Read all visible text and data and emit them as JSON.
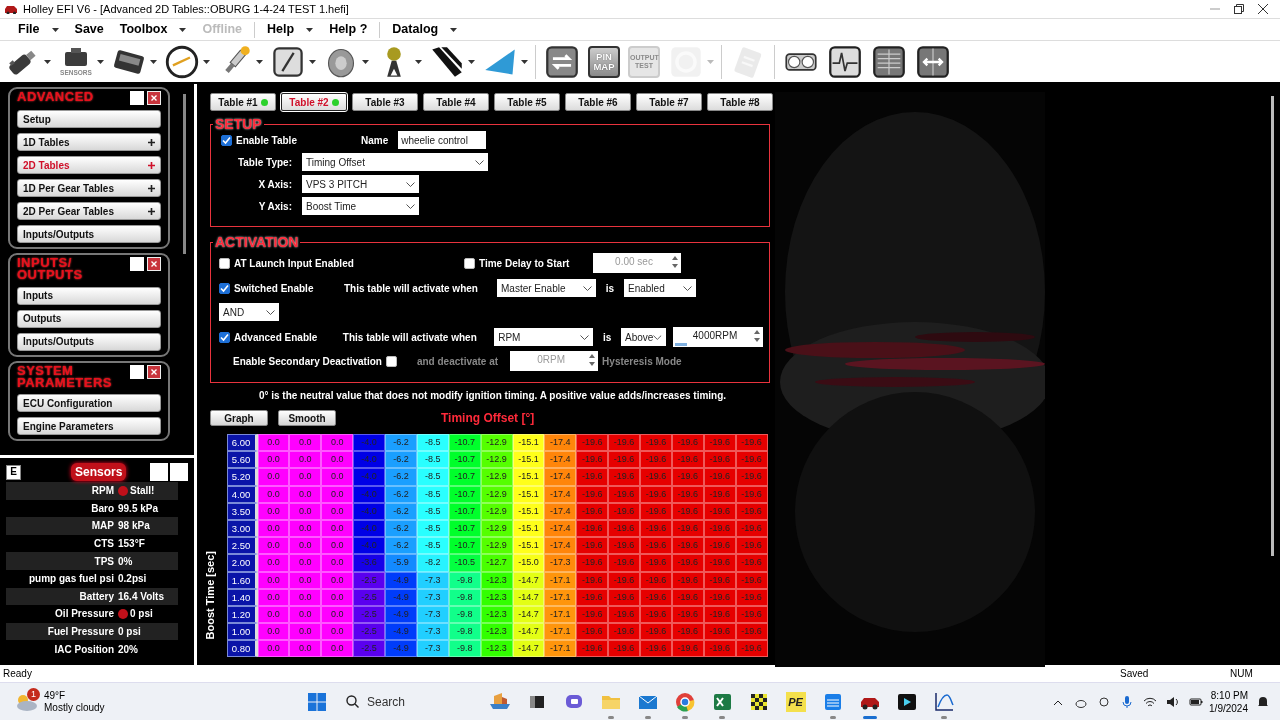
{
  "window": {
    "title": "Holley EFI V6 - [Advanced 2D Tables::OBURG 1-4-24 TEST 1.hefi]"
  },
  "menu_groups": [
    [
      {
        "label": "File",
        "dropdown": true,
        "disabled": false
      },
      {
        "label": "Save",
        "dropdown": false,
        "disabled": false
      },
      {
        "label": "Toolbox",
        "dropdown": true,
        "disabled": false
      },
      {
        "label": "Offline",
        "dropdown": false,
        "disabled": true
      }
    ],
    [
      {
        "label": "Help",
        "dropdown": true,
        "disabled": false
      },
      {
        "label": "Help ?",
        "dropdown": false,
        "disabled": false
      }
    ],
    [
      {
        "label": "Datalog",
        "dropdown": true,
        "disabled": false
      }
    ]
  ],
  "toolbar_groups": [
    [
      {
        "dropdown": true,
        "disabled": false
      },
      {
        "label": "SENSORS",
        "dropdown": true,
        "disabled": false
      },
      {
        "dropdown": true,
        "disabled": false
      },
      {
        "dropdown": true,
        "disabled": false
      },
      {
        "dropdown": true,
        "disabled": false
      },
      {
        "dropdown": true,
        "disabled": false
      },
      {
        "dropdown": true,
        "disabled": false
      },
      {
        "dropdown": true,
        "disabled": false
      },
      {
        "dropdown": true,
        "disabled": false
      },
      {
        "dropdown": true,
        "disabled": false
      }
    ],
    [
      {
        "dropdown": false,
        "disabled": false
      },
      {
        "label": "PIN MAP",
        "dropdown": false,
        "disabled": false
      },
      {
        "label": "OUTPUT TEST",
        "dropdown": false,
        "disabled": true
      },
      {
        "dropdown": true,
        "disabled": true
      }
    ],
    [
      {
        "dropdown": false,
        "disabled": true
      }
    ],
    [
      {
        "dropdown": false,
        "disabled": false
      },
      {
        "dropdown": false,
        "disabled": false
      },
      {
        "dropdown": false,
        "disabled": false
      },
      {
        "dropdown": false,
        "disabled": false
      }
    ]
  ],
  "side_panels": [
    {
      "title": "ADVANCED",
      "items": [
        {
          "label": "Setup",
          "expandable": false,
          "selected": false
        },
        {
          "label": "1D Tables",
          "expandable": true,
          "selected": false
        },
        {
          "label": "2D Tables",
          "expandable": true,
          "selected": true
        },
        {
          "label": "1D Per Gear Tables",
          "expandable": true,
          "selected": false
        },
        {
          "label": "2D Per Gear Tables",
          "expandable": true,
          "selected": false
        },
        {
          "label": "Inputs/Outputs",
          "expandable": false,
          "selected": false
        }
      ]
    },
    {
      "title": "INPUTS/ OUTPUTS",
      "items": [
        {
          "label": "Inputs",
          "expandable": false,
          "selected": false
        },
        {
          "label": "Outputs",
          "expandable": false,
          "selected": false
        },
        {
          "label": "Inputs/Outputs",
          "expandable": false,
          "selected": false
        }
      ]
    },
    {
      "title": "SYSTEM PARAMETERS",
      "items": [
        {
          "label": "ECU Configuration",
          "expandable": false,
          "selected": false
        },
        {
          "label": "Engine Parameters",
          "expandable": false,
          "selected": false
        }
      ]
    }
  ],
  "sensors": {
    "button": "E",
    "title": "Sensors",
    "rows": [
      {
        "label": "RPM",
        "value": "Stall!",
        "alert": true
      },
      {
        "label": "Baro",
        "value": "99.5 kPa",
        "alert": false
      },
      {
        "label": "MAP",
        "value": "98 kPa",
        "alert": false
      },
      {
        "label": "CTS",
        "value": "153°F",
        "alert": false
      },
      {
        "label": "TPS",
        "value": "0%",
        "alert": false
      },
      {
        "label": "pump gas fuel psi",
        "value": "0.2psi",
        "alert": false
      },
      {
        "label": "Battery",
        "value": "16.4 Volts",
        "alert": false
      },
      {
        "label": "Oil Pressure",
        "value": "0 psi",
        "alert": true
      },
      {
        "label": "Fuel Pressure",
        "value": "0 psi",
        "alert": false
      },
      {
        "label": "IAC Position",
        "value": "20%",
        "alert": false
      }
    ]
  },
  "tabs": [
    {
      "label": "Table #1",
      "enabled": true,
      "selected": false
    },
    {
      "label": "Table #2",
      "enabled": true,
      "selected": true
    },
    {
      "label": "Table #3",
      "enabled": false,
      "selected": false
    },
    {
      "label": "Table #4",
      "enabled": false,
      "selected": false
    },
    {
      "label": "Table #5",
      "enabled": false,
      "selected": false
    },
    {
      "label": "Table #6",
      "enabled": false,
      "selected": false
    },
    {
      "label": "Table #7",
      "enabled": false,
      "selected": false
    },
    {
      "label": "Table #8",
      "enabled": false,
      "selected": false
    }
  ],
  "setup": {
    "title": "SETUP",
    "enable_table": {
      "label": "Enable Table",
      "checked": true
    },
    "name": {
      "label": "Name",
      "value": "wheelie control"
    },
    "fields": [
      {
        "label": "Table Type:",
        "value": "Timing Offset"
      },
      {
        "label": "X Axis:",
        "value": "VPS 3 PITCH"
      },
      {
        "label": "Y Axis:",
        "value": "Boost Time"
      }
    ]
  },
  "activation": {
    "title": "ACTIVATION",
    "at_launch": {
      "label": "AT Launch Input Enabled",
      "checked": false
    },
    "time_delay": {
      "label": "Time Delay to Start",
      "checked": false,
      "value": "0.00 sec",
      "disabled": true
    },
    "switched": {
      "label": "Switched Enable",
      "checked": true,
      "condition": "This table will activate when",
      "source": "Master Enable",
      "is": "is",
      "state": "Enabled"
    },
    "logic": "AND",
    "advanced": {
      "label": "Advanced Enable",
      "checked": true,
      "condition": "This table will activate when",
      "source": "RPM",
      "is": "is",
      "comparison": "Above",
      "value": "4000RPM",
      "level": 0.15
    },
    "secondary": {
      "label": "Enable Secondary Deactivation",
      "checked": false,
      "deactivate_label": "and deactivate at",
      "value": "0RPM",
      "mode": "Hysteresis Mode",
      "disabled": true
    }
  },
  "note": "0° is the neutral value that does not modify ignition timing.  A positive value adds/increases timing.",
  "buttons": [
    "Graph",
    "Smooth"
  ],
  "table": {
    "title": "Timing Offset [°]",
    "y_label": "Boost Time [sec]",
    "rows": [
      {
        "label": "6.00",
        "values": [
          "0.0",
          "0.0",
          "0.0",
          "-4.0",
          "-6.2",
          "-8.5",
          "-10.7",
          "-12.9",
          "-15.1",
          "-17.4",
          "-19.6",
          "-19.6",
          "-19.6",
          "-19.6",
          "-19.6",
          "-19.6"
        ]
      },
      {
        "label": "5.60",
        "values": [
          "0.0",
          "0.0",
          "0.0",
          "-4.0",
          "-6.2",
          "-8.5",
          "-10.7",
          "-12.9",
          "-15.1",
          "-17.4",
          "-19.6",
          "-19.6",
          "-19.6",
          "-19.6",
          "-19.6",
          "-19.6"
        ]
      },
      {
        "label": "5.20",
        "values": [
          "0.0",
          "0.0",
          "0.0",
          "-4.0",
          "-6.2",
          "-8.5",
          "-10.7",
          "-12.9",
          "-15.1",
          "-17.4",
          "-19.6",
          "-19.6",
          "-19.6",
          "-19.6",
          "-19.6",
          "-19.6"
        ]
      },
      {
        "label": "4.00",
        "values": [
          "0.0",
          "0.0",
          "0.0",
          "-4.0",
          "-6.2",
          "-8.5",
          "-10.7",
          "-12.9",
          "-15.1",
          "-17.4",
          "-19.6",
          "-19.6",
          "-19.6",
          "-19.6",
          "-19.6",
          "-19.6"
        ]
      },
      {
        "label": "3.50",
        "values": [
          "0.0",
          "0.0",
          "0.0",
          "-4.0",
          "-6.2",
          "-8.5",
          "-10.7",
          "-12.9",
          "-15.1",
          "-17.4",
          "-19.6",
          "-19.6",
          "-19.6",
          "-19.6",
          "-19.6",
          "-19.6"
        ]
      },
      {
        "label": "3.00",
        "values": [
          "0.0",
          "0.0",
          "0.0",
          "-4.0",
          "-6.2",
          "-8.5",
          "-10.7",
          "-12.9",
          "-15.1",
          "-17.4",
          "-19.6",
          "-19.6",
          "-19.6",
          "-19.6",
          "-19.6",
          "-19.6"
        ]
      },
      {
        "label": "2.50",
        "values": [
          "0.0",
          "0.0",
          "0.0",
          "-4.0",
          "-6.2",
          "-8.5",
          "-10.7",
          "-12.9",
          "-15.1",
          "-17.4",
          "-19.6",
          "-19.6",
          "-19.6",
          "-19.6",
          "-19.6",
          "-19.6"
        ]
      },
      {
        "label": "2.00",
        "values": [
          "0.0",
          "0.0",
          "0.0",
          "-3.6",
          "-5.9",
          "-8.2",
          "-10.5",
          "-12.7",
          "-15.0",
          "-17.3",
          "-19.6",
          "-19.6",
          "-19.6",
          "-19.6",
          "-19.6",
          "-19.6"
        ]
      },
      {
        "label": "1.60",
        "values": [
          "0.0",
          "0.0",
          "0.0",
          "-2.5",
          "-4.9",
          "-7.3",
          "-9.8",
          "-12.3",
          "-14.7",
          "-17.1",
          "-19.6",
          "-19.6",
          "-19.6",
          "-19.6",
          "-19.6",
          "-19.6"
        ]
      },
      {
        "label": "1.40",
        "values": [
          "0.0",
          "0.0",
          "0.0",
          "-2.5",
          "-4.9",
          "-7.3",
          "-9.8",
          "-12.3",
          "-14.7",
          "-17.1",
          "-19.6",
          "-19.6",
          "-19.6",
          "-19.6",
          "-19.6",
          "-19.6"
        ]
      },
      {
        "label": "1.20",
        "values": [
          "0.0",
          "0.0",
          "0.0",
          "-2.5",
          "-4.9",
          "-7.3",
          "-9.8",
          "-12.3",
          "-14.7",
          "-17.1",
          "-19.6",
          "-19.6",
          "-19.6",
          "-19.6",
          "-19.6",
          "-19.6"
        ]
      },
      {
        "label": "1.00",
        "values": [
          "0.0",
          "0.0",
          "0.0",
          "-2.5",
          "-4.9",
          "-7.3",
          "-9.8",
          "-12.3",
          "-14.7",
          "-17.1",
          "-19.6",
          "-19.6",
          "-19.6",
          "-19.6",
          "-19.6",
          "-19.6"
        ]
      },
      {
        "label": "0.80",
        "values": [
          "0.0",
          "0.0",
          "0.0",
          "-2.5",
          "-4.9",
          "-7.3",
          "-9.8",
          "-12.3",
          "-14.7",
          "-17.1",
          "-19.6",
          "-19.6",
          "-19.6",
          "-19.6",
          "-19.6",
          "-19.6"
        ]
      }
    ]
  },
  "status_bar": {
    "left": "Ready",
    "saved": "Saved",
    "num": "NUM"
  },
  "taskbar": {
    "weather": {
      "badge": "1",
      "temp": "49°F",
      "desc": "Mostly cloudy"
    },
    "search": {
      "placeholder": "Search"
    },
    "apps": [
      {
        "open": false,
        "active": false
      },
      {
        "open": false,
        "active": false
      },
      {
        "open": false,
        "active": false
      },
      {
        "open": true,
        "active": false
      },
      {
        "open": true,
        "active": false
      },
      {
        "open": true,
        "active": false
      },
      {
        "open": true,
        "active": false
      },
      {
        "open": false,
        "active": false
      },
      {
        "label": "PE",
        "open": false,
        "active": false
      },
      {
        "open": true,
        "active": false
      },
      {
        "open": true,
        "active": true
      },
      {
        "open": false,
        "active": false
      },
      {
        "open": true,
        "active": false
      }
    ],
    "time": "8:10 PM",
    "date": "1/9/2024"
  }
}
